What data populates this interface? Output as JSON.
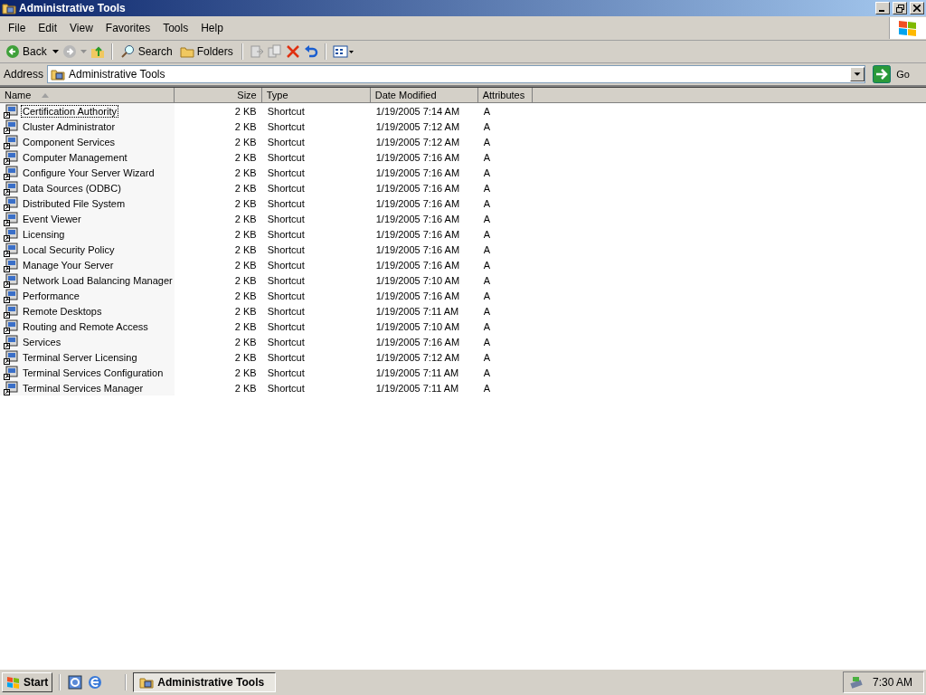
{
  "window": {
    "title": "Administrative Tools"
  },
  "menu": [
    "File",
    "Edit",
    "View",
    "Favorites",
    "Tools",
    "Help"
  ],
  "toolbar": {
    "back": "Back",
    "forward": {
      "disabled": true
    },
    "search": "Search",
    "folders": "Folders"
  },
  "address": {
    "label": "Address",
    "value": "Administrative Tools",
    "go": "Go"
  },
  "table": {
    "columns": [
      {
        "label": "Name",
        "sorted": true
      },
      {
        "label": "Size",
        "sorted": false
      },
      {
        "label": "Type",
        "sorted": false
      },
      {
        "label": "Date Modified",
        "sorted": false
      },
      {
        "label": "Attributes",
        "sorted": false
      }
    ],
    "rows": [
      {
        "name": "Certification Authority",
        "size": "2 KB",
        "type": "Shortcut",
        "date": "1/19/2005 7:14 AM",
        "attributes": "A",
        "focused": true
      },
      {
        "name": "Cluster Administrator",
        "size": "2 KB",
        "type": "Shortcut",
        "date": "1/19/2005 7:12 AM",
        "attributes": "A",
        "focused": false
      },
      {
        "name": "Component Services",
        "size": "2 KB",
        "type": "Shortcut",
        "date": "1/19/2005 7:12 AM",
        "attributes": "A",
        "focused": false
      },
      {
        "name": "Computer Management",
        "size": "2 KB",
        "type": "Shortcut",
        "date": "1/19/2005 7:16 AM",
        "attributes": "A",
        "focused": false
      },
      {
        "name": "Configure Your Server Wizard",
        "size": "2 KB",
        "type": "Shortcut",
        "date": "1/19/2005 7:16 AM",
        "attributes": "A",
        "focused": false
      },
      {
        "name": "Data Sources (ODBC)",
        "size": "2 KB",
        "type": "Shortcut",
        "date": "1/19/2005 7:16 AM",
        "attributes": "A",
        "focused": false
      },
      {
        "name": "Distributed File System",
        "size": "2 KB",
        "type": "Shortcut",
        "date": "1/19/2005 7:16 AM",
        "attributes": "A",
        "focused": false
      },
      {
        "name": "Event Viewer",
        "size": "2 KB",
        "type": "Shortcut",
        "date": "1/19/2005 7:16 AM",
        "attributes": "A",
        "focused": false
      },
      {
        "name": "Licensing",
        "size": "2 KB",
        "type": "Shortcut",
        "date": "1/19/2005 7:16 AM",
        "attributes": "A",
        "focused": false
      },
      {
        "name": "Local Security Policy",
        "size": "2 KB",
        "type": "Shortcut",
        "date": "1/19/2005 7:16 AM",
        "attributes": "A",
        "focused": false
      },
      {
        "name": "Manage Your Server",
        "size": "2 KB",
        "type": "Shortcut",
        "date": "1/19/2005 7:16 AM",
        "attributes": "A",
        "focused": false
      },
      {
        "name": "Network Load Balancing Manager",
        "size": "2 KB",
        "type": "Shortcut",
        "date": "1/19/2005 7:10 AM",
        "attributes": "A",
        "focused": false
      },
      {
        "name": "Performance",
        "size": "2 KB",
        "type": "Shortcut",
        "date": "1/19/2005 7:16 AM",
        "attributes": "A",
        "focused": false
      },
      {
        "name": "Remote Desktops",
        "size": "2 KB",
        "type": "Shortcut",
        "date": "1/19/2005 7:11 AM",
        "attributes": "A",
        "focused": false
      },
      {
        "name": "Routing and Remote Access",
        "size": "2 KB",
        "type": "Shortcut",
        "date": "1/19/2005 7:10 AM",
        "attributes": "A",
        "focused": false
      },
      {
        "name": "Services",
        "size": "2 KB",
        "type": "Shortcut",
        "date": "1/19/2005 7:16 AM",
        "attributes": "A",
        "focused": false
      },
      {
        "name": "Terminal Server Licensing",
        "size": "2 KB",
        "type": "Shortcut",
        "date": "1/19/2005 7:12 AM",
        "attributes": "A",
        "focused": false
      },
      {
        "name": "Terminal Services Configuration",
        "size": "2 KB",
        "type": "Shortcut",
        "date": "1/19/2005 7:11 AM",
        "attributes": "A",
        "focused": false
      },
      {
        "name": "Terminal Services Manager",
        "size": "2 KB",
        "type": "Shortcut",
        "date": "1/19/2005 7:11 AM",
        "attributes": "A",
        "focused": false
      }
    ]
  },
  "taskbar": {
    "start": "Start",
    "tasks": [
      {
        "label": "Administrative Tools",
        "selected": true
      }
    ],
    "clock": "7:30 AM"
  }
}
